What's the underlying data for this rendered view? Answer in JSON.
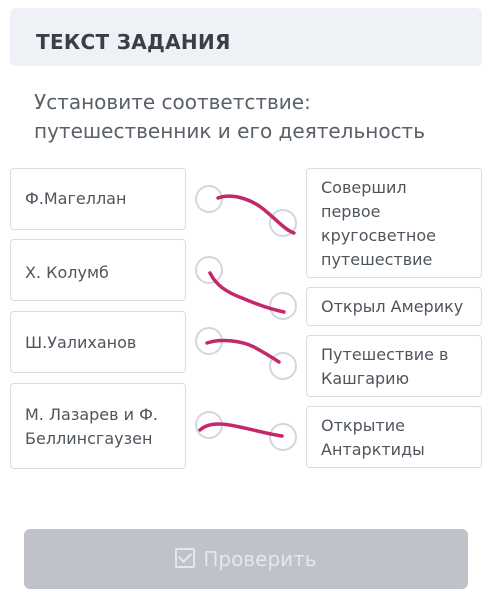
{
  "header": {
    "title": "ТЕКСТ ЗАДАНИЯ"
  },
  "task": {
    "instruction": "Установите соответствие: путешественник и его деятельность"
  },
  "left_items": [
    "Ф.Магеллан",
    "Х. Колумб",
    "Ш.Уалиханов",
    "М. Лазарев и Ф. Беллинсгаузен"
  ],
  "right_items": [
    "Совершил первое кругосветное путешествие",
    "Открыл Америку",
    "Путешествие в Кашгарию",
    "Открытие Антарктиды"
  ],
  "colors": {
    "hand_drawn_line": "#c4286b",
    "card_border": "#d9dde2"
  },
  "footer": {
    "check_label": "Проверить"
  }
}
